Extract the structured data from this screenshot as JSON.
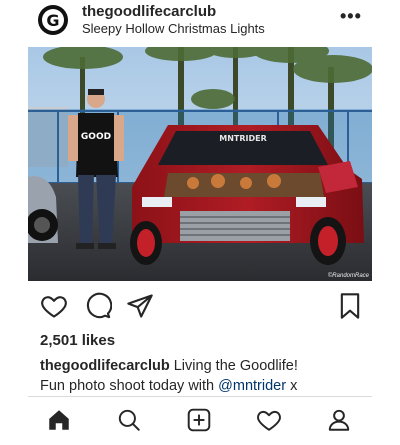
{
  "post": {
    "username": "thegoodlifecarclub",
    "location": "Sleepy Hollow Christmas Lights",
    "more_label": "•••",
    "avatar_letter": "G"
  },
  "photo": {
    "banner_text": "MNTRIDER",
    "shirt_text": "GOOD",
    "credit": "©RandomRace"
  },
  "engagement": {
    "likes": "2,501 likes"
  },
  "caption": {
    "user": "thegoodlifecarclub",
    "text": " Living the Goodlife!",
    "line2": "Fun photo shoot today with ",
    "mention": "@mntrider",
    "tail": " x"
  },
  "icons": {
    "like": "heart-icon",
    "comment": "comment-icon",
    "share": "send-icon",
    "save": "bookmark-icon",
    "home": "home-icon",
    "search": "search-icon",
    "new_post": "add-post-icon",
    "activity": "heart-icon",
    "profile": "profile-icon"
  },
  "colors": {
    "text": "#262626",
    "mention": "#003569",
    "divider": "#dbdbdb"
  }
}
